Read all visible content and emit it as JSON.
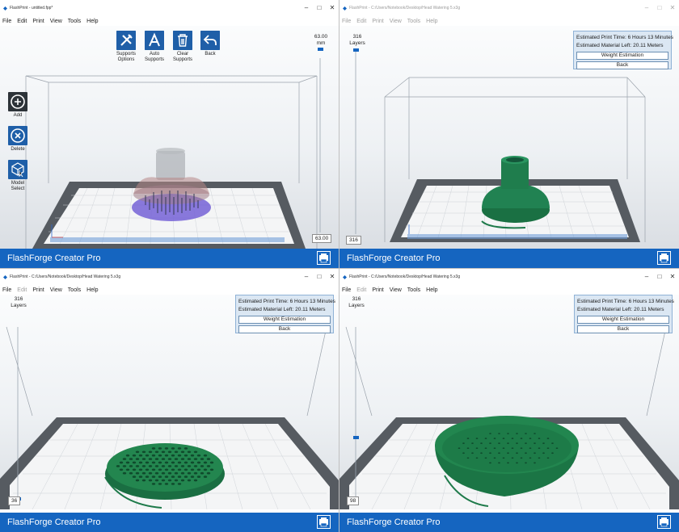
{
  "windows": [
    {
      "title": "FlashPrint - untitled.fpp*",
      "menu_inactive": false,
      "menu": [
        "File",
        "Edit",
        "Print",
        "View",
        "Tools",
        "Help"
      ],
      "toolbar": [
        {
          "label": "Supports Options",
          "icon": "wrench-screwdriver-icon"
        },
        {
          "label": "Auto Supports",
          "icon": "letter-a-icon"
        },
        {
          "label": "Clear Supports",
          "icon": "trash-icon"
        },
        {
          "label": "Back",
          "icon": "back-arrow-icon"
        }
      ],
      "side_tools": [
        {
          "label": "Add",
          "icon": "plus-circle-icon"
        },
        {
          "label": "Delete",
          "icon": "x-circle-icon"
        },
        {
          "label": "Model Select",
          "icon": "cube-cursor-icon"
        }
      ],
      "height_value": "63.00",
      "height_unit": "mm",
      "height_box": "63.00",
      "printer": "FlashForge Creator Pro"
    },
    {
      "title": "FlashPrint - C:/Users/Notebook/Desktop/Head Watering 5.x3g",
      "menu_inactive": true,
      "menu": [
        "File",
        "Edit",
        "Print",
        "View",
        "Tools",
        "Help"
      ],
      "layers_count": "316",
      "layers_label": "Layers",
      "layer_box": "316",
      "layer_fraction": 1.0,
      "info": {
        "time": "Estimated Print Time: 6 Hours 13 Minutes",
        "material": "Estimated Material Left: 20.11 Meters",
        "weight_btn": "Weight Estimation",
        "back_btn": "Back"
      },
      "printer": "FlashForge Creator Pro"
    },
    {
      "title": "FlashPrint - C:/Users/Notebook/Desktop/Head Watering 5.x3g",
      "menu_inactive": false,
      "menu": [
        "File",
        "Edit",
        "Print",
        "View",
        "Tools",
        "Help"
      ],
      "layers_count": "316",
      "layers_label": "Layers",
      "layer_box": "36",
      "layer_fraction": 0.114,
      "info": {
        "time": "Estimated Print Time: 6 Hours 13 Minutes",
        "material": "Estimated Material Left: 20.11 Meters",
        "weight_btn": "Weight Estimation",
        "back_btn": "Back"
      },
      "printer": "FlashForge Creator Pro"
    },
    {
      "title": "FlashPrint - C:/Users/Notebook/Desktop/Head Watering 5.x3g",
      "menu_inactive": false,
      "menu": [
        "File",
        "Edit",
        "Print",
        "View",
        "Tools",
        "Help"
      ],
      "layers_count": "316",
      "layers_label": "Layers",
      "layer_box": "98",
      "layer_fraction": 0.31,
      "info": {
        "time": "Estimated Print Time: 6 Hours 13 Minutes",
        "material": "Estimated Material Left: 20.11 Meters",
        "weight_btn": "Weight Estimation",
        "back_btn": "Back"
      },
      "printer": "FlashForge Creator Pro"
    }
  ],
  "colors": {
    "accent": "#1565c0",
    "model_green": "#1e7a4a",
    "support_purple": "#6d5bd0",
    "model_ghost": "#a67c7c",
    "plate_dark": "#555a60"
  }
}
